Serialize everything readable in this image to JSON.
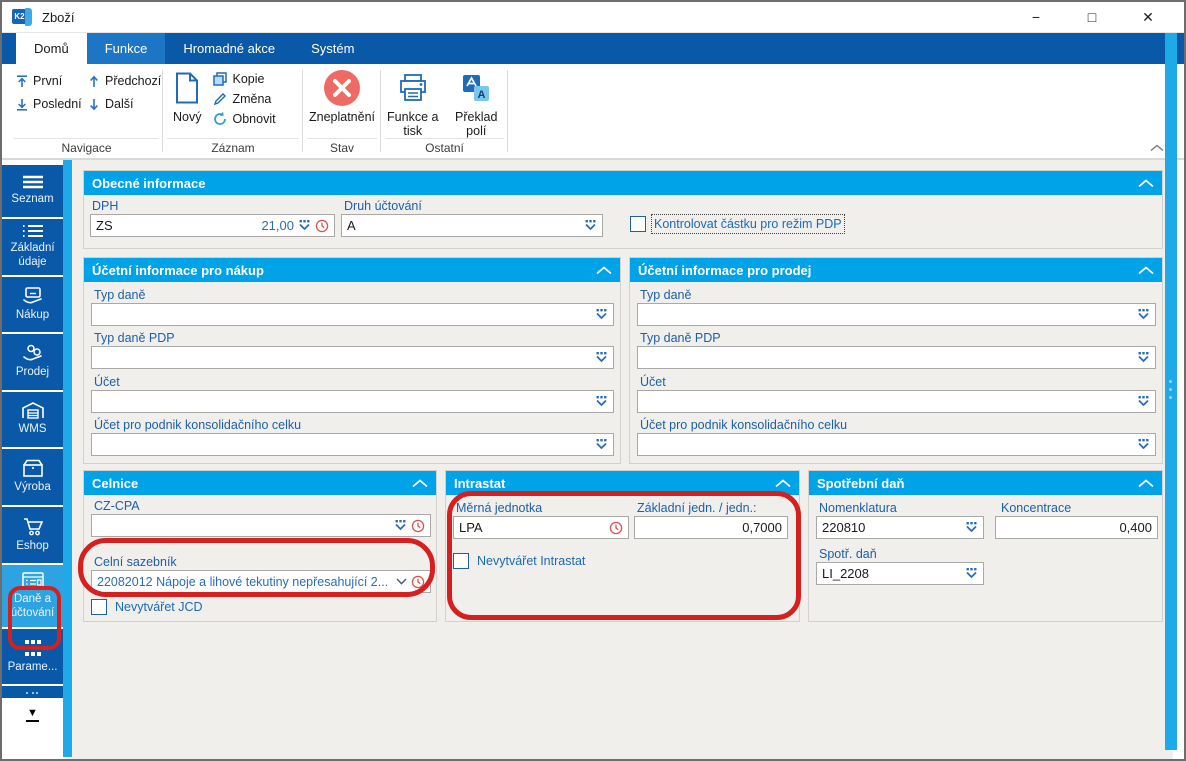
{
  "window": {
    "title": "Zboží",
    "logo": "K2",
    "minimize": "−",
    "maximize": "□",
    "close": "✕"
  },
  "tabs": [
    {
      "label": "Domů",
      "state": "active"
    },
    {
      "label": "Funkce",
      "state": "highlight"
    },
    {
      "label": "Hromadné akce",
      "state": "normal"
    },
    {
      "label": "Systém",
      "state": "normal"
    }
  ],
  "ribbon": {
    "groups": [
      {
        "label": "Navigace",
        "buttons": [
          {
            "label": "První",
            "icon": "arrow-up-to-bar"
          },
          {
            "label": "Předchozí",
            "icon": "arrow-up"
          },
          {
            "label": "Poslední",
            "icon": "arrow-down-to-bar"
          },
          {
            "label": "Další",
            "icon": "arrow-down"
          }
        ]
      },
      {
        "label": "Záznam",
        "buttons": [
          {
            "label": "Nový",
            "icon": "new-document"
          },
          {
            "label": "Kopie",
            "icon": "copy"
          },
          {
            "label": "Změna",
            "icon": "pencil"
          },
          {
            "label": "Obnovit",
            "icon": "refresh"
          }
        ]
      },
      {
        "label": "Stav",
        "buttons": [
          {
            "label": "Zneplatnění",
            "icon": "invalidate-red-x"
          }
        ]
      },
      {
        "label": "Ostatní",
        "buttons": [
          {
            "label": "Funkce a tisk",
            "icon": "printer"
          },
          {
            "label": "Překlad polí",
            "icon": "translate"
          }
        ]
      }
    ]
  },
  "sidebar": {
    "items": [
      {
        "label": "Seznam",
        "icon": "menu-lines"
      },
      {
        "label": "Základní údaje",
        "icon": "detail-list"
      },
      {
        "label": "Nákup",
        "icon": "hand-card"
      },
      {
        "label": "Prodej",
        "icon": "hand-coins"
      },
      {
        "label": "WMS",
        "icon": "warehouse"
      },
      {
        "label": "Výroba",
        "icon": "box"
      },
      {
        "label": "Eshop",
        "icon": "cart"
      },
      {
        "label": "Daně a účtování",
        "icon": "tax-form",
        "active": true,
        "annotated": true
      },
      {
        "label": "Parame...",
        "icon": "grid"
      }
    ],
    "more_glyph": "▼"
  },
  "panels": {
    "obecne": {
      "title": "Obecné informace",
      "dph_label": "DPH",
      "dph_value": "ZS",
      "dph_rate": "21,00",
      "druh_label": "Druh účtování",
      "druh_value": "A",
      "checkbox": "Kontrolovat částku pro režim PDP"
    },
    "nakup": {
      "title": "Účetní informace pro nákup",
      "fields": [
        "Typ daně",
        "Typ daně PDP",
        "Účet",
        "Účet pro podnik konsolidačního celku"
      ]
    },
    "prodej": {
      "title": "Účetní informace pro prodej",
      "fields": [
        "Typ daně",
        "Typ daně PDP",
        "Účet",
        "Účet pro podnik konsolidačního celku"
      ]
    },
    "celnice": {
      "title": "Celnice",
      "czcpa_label": "CZ-CPA",
      "sazebnik_label": "Celní sazebník",
      "sazebnik_value": "22082012 Nápoje a lihové tekutiny nepřesahující 2...",
      "checkbox": "Nevytvářet JCD"
    },
    "intrastat": {
      "title": "Intrastat",
      "mj_label": "Měrná jednotka",
      "mj_value": "LPA",
      "zakl_label": "Základní jedn. / jedn.:",
      "zakl_value": "0,7000",
      "checkbox": "Nevytvářet Intrastat"
    },
    "spotrebni": {
      "title": "Spotřební daň",
      "nomen_label": "Nomenklatura",
      "nomen_value": "220810",
      "konc_label": "Koncentrace",
      "konc_value": "0,400",
      "spotr_label": "Spotř. daň",
      "spotr_value": "LI_2208"
    }
  },
  "colors": {
    "accent_blue": "#0a58a8",
    "tab_highlight": "#1c75c5",
    "panel_header": "#00a2e8",
    "sidebar_active": "#2da3e2",
    "annotation_red": "#d61f1f",
    "invalid_red": "#ee6a64",
    "icon_blue": "#1e6bb8",
    "label_blue": "#1d5fa8"
  }
}
